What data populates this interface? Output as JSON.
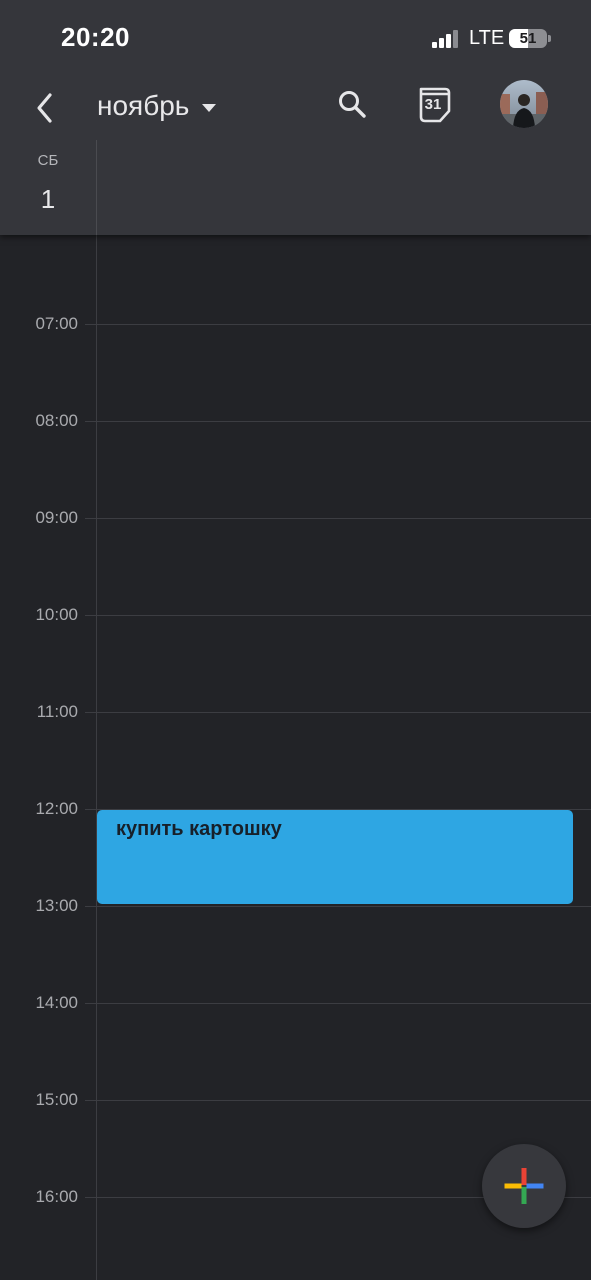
{
  "status_bar": {
    "time": "20:20",
    "network": "LTE",
    "battery": "51",
    "battery_level": 0.51,
    "signal_bars": 3
  },
  "toolbar": {
    "back_icon": "chevron-left-icon",
    "month": "ноябрь",
    "dropdown_icon": "triangle-down-icon",
    "search_icon": "search-icon",
    "today_date": "31",
    "today_icon": "calendar-today-icon",
    "avatar_icon": "user-avatar"
  },
  "day_header": {
    "weekday": "СБ",
    "date": "1"
  },
  "hours": [
    {
      "label": "07:00"
    },
    {
      "label": "08:00"
    },
    {
      "label": "09:00"
    },
    {
      "label": "10:00"
    },
    {
      "label": "11:00"
    },
    {
      "label": "12:00"
    },
    {
      "label": "13:00"
    },
    {
      "label": "14:00"
    },
    {
      "label": "15:00"
    },
    {
      "label": "16:00"
    }
  ],
  "events": [
    {
      "title": "купить картошку",
      "color": "#2ea6e3"
    }
  ],
  "fab": {
    "icon": "plus-icon",
    "colors": [
      "#ea4335",
      "#4285f4",
      "#34a853",
      "#fbbc04"
    ]
  },
  "colors": {
    "header_bg": "#35363b",
    "body_bg": "#222327",
    "grid_line": "#3c3d42"
  }
}
